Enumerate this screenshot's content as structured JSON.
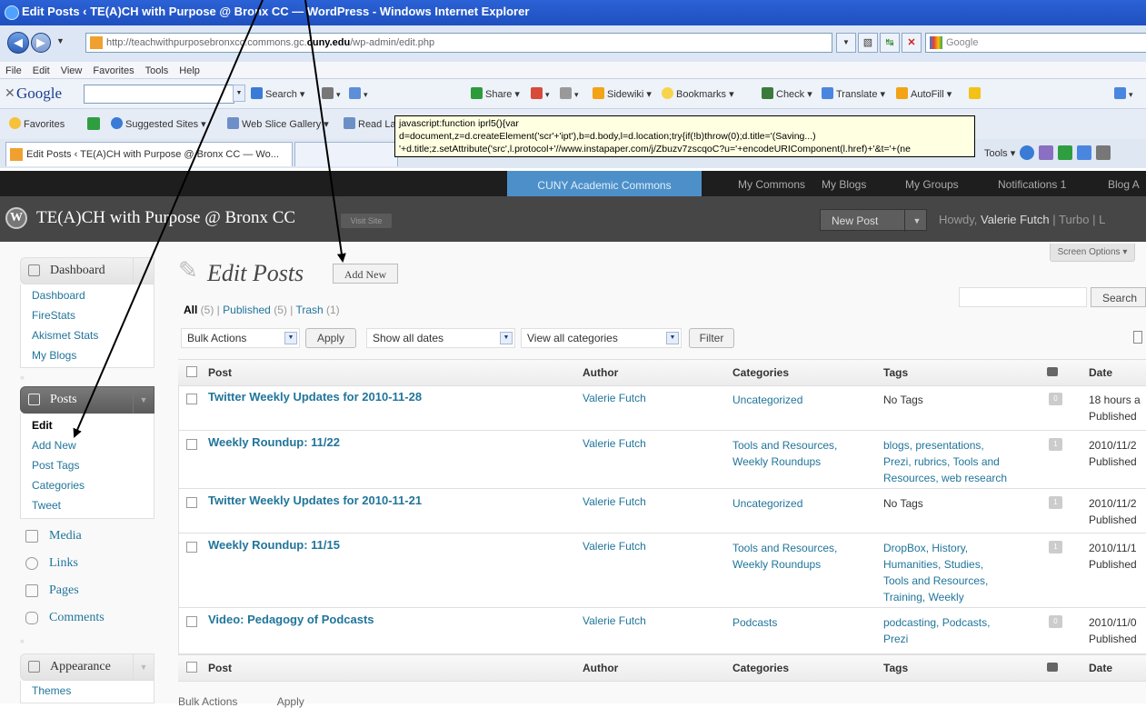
{
  "window": {
    "title": "Edit Posts ‹ TE(A)CH with Purpose @ Bronx CC — WordPress - Windows Internet Explorer"
  },
  "address_bar": {
    "url_prefix": "http://teachwithpurposebronxcc.commons.gc.",
    "url_bold": "cuny.edu",
    "url_suffix": "/wp-admin/edit.php",
    "search_placeholder": "Google"
  },
  "menu_bar": [
    "File",
    "Edit",
    "View",
    "Favorites",
    "Tools",
    "Help"
  ],
  "google_toolbar": {
    "logo": "Google",
    "items": [
      "Search ▾",
      "Share ▾",
      "Sidewiki ▾",
      "Bookmarks ▾",
      "Check ▾",
      "Translate ▾",
      "AutoFill ▾"
    ]
  },
  "favorites_bar": {
    "favorites": "Favorites",
    "items": [
      "Suggested Sites ▾",
      "Web Slice Gallery ▾",
      "Read Later"
    ]
  },
  "tabs": {
    "active": "Edit Posts ‹ TE(A)CH with Purpose @ Bronx CC — Wo...",
    "tools": "Tools ▾"
  },
  "tooltip": "javascript:function iprl5(){var\nd=document,z=d.createElement('scr'+'ipt'),b=d.body,l=d.location;try{if(!b)throw(0);d.title='(Saving...)\n'+d.title;z.setAttribute('src',l.protocol+'//www.instapaper.com/j/Zbuzv7zscqoC?u='+encodeURIComponent(l.href)+'&t='+(ne",
  "commons_bar": {
    "active": "CUNY Academic Commons",
    "items": [
      "My Commons",
      "My Blogs",
      "My Groups",
      "Notifications 1",
      "Blog A"
    ]
  },
  "admin_head": {
    "logo": "W",
    "site_title": "TE(A)CH with Purpose @ Bronx CC",
    "visit_site": "Visit Site",
    "new_post": "New Post",
    "howdy_prefix": "Howdy, ",
    "user": "Valerie Futch",
    "links": " | Turbo | L"
  },
  "screen_options": "Screen Options ▾",
  "sidebar": {
    "dashboard_head": "Dashboard",
    "dashboard_items": [
      "Dashboard",
      "FireStats",
      "Akismet Stats",
      "My Blogs"
    ],
    "posts_head": "Posts",
    "posts_items": [
      "Edit",
      "Add New",
      "Post Tags",
      "Categories",
      "Tweet"
    ],
    "media": "Media",
    "links": "Links",
    "pages": "Pages",
    "comments": "Comments",
    "appearance_head": "Appearance",
    "appearance_items": [
      "Themes"
    ]
  },
  "page": {
    "title": "Edit Posts",
    "add_new": "Add New",
    "filters": {
      "all": "All",
      "all_count": " (5)",
      "published": "Published",
      "published_count": " (5)",
      "trash": "Trash",
      "trash_count": " (1)"
    },
    "search_button": "Search",
    "bulk_actions": "Bulk Actions",
    "apply": "Apply",
    "dates": "Show all dates",
    "categories": "View all categories",
    "filter": "Filter"
  },
  "table": {
    "columns": [
      "Post",
      "Author",
      "Categories",
      "Tags",
      "Date"
    ],
    "rows": [
      {
        "title": "Twitter Weekly Updates for 2010-11-28",
        "author": "Valerie Futch",
        "categories": [
          "Uncategorized"
        ],
        "tags": [
          "No Tags"
        ],
        "comments": "0",
        "date": [
          "18 hours a",
          "Published"
        ]
      },
      {
        "title": "Weekly Roundup: 11/22",
        "author": "Valerie Futch",
        "categories": [
          "Tools and Resources,",
          "Weekly Roundups"
        ],
        "tags": [
          "blogs, presentations,",
          "Prezi, rubrics, Tools and",
          "Resources, web research"
        ],
        "comments": "1",
        "date": [
          "2010/11/2",
          "Published"
        ]
      },
      {
        "title": "Twitter Weekly Updates for 2010-11-21",
        "author": "Valerie Futch",
        "categories": [
          "Uncategorized"
        ],
        "tags": [
          "No Tags"
        ],
        "comments": "1",
        "date": [
          "2010/11/2",
          "Published"
        ]
      },
      {
        "title": "Weekly Roundup: 11/15",
        "author": "Valerie Futch",
        "categories": [
          "Tools and Resources,",
          "Weekly Roundups"
        ],
        "tags": [
          "DropBox, History,",
          "Humanities, Studies,",
          "Tools and Resources,",
          "Training, Weekly"
        ],
        "comments": "1",
        "date": [
          "2010/11/1",
          "Published"
        ]
      },
      {
        "title": "Video: Pedagogy of Podcasts",
        "author": "Valerie Futch",
        "categories": [
          "Podcasts"
        ],
        "tags": [
          "podcasting, Podcasts,",
          "Prezi"
        ],
        "comments": "0",
        "date": [
          "2010/11/0",
          "Published"
        ]
      }
    ]
  },
  "bottom": {
    "bulk_actions": "Bulk Actions",
    "apply": "Apply"
  }
}
